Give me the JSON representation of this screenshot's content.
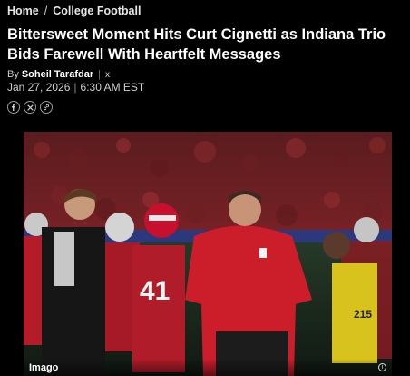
{
  "breadcrumb": {
    "home": "Home",
    "separator": "/",
    "section": "College Football"
  },
  "article": {
    "headline": "Bittersweet Moment Hits Curt Cignetti as Indiana Trio Bids Farewell With Heartfelt Messages",
    "by_prefix": "By",
    "author": "Soheil Tarafdar",
    "author_social": "x",
    "date": "Jan 27, 2026",
    "time": "6:30 AM EST"
  },
  "share": {
    "icons": [
      "facebook-icon",
      "x-icon",
      "link-icon"
    ]
  },
  "image": {
    "credit": "Imago",
    "jersey_numbers": [
      "41",
      "215"
    ]
  },
  "colors": {
    "background": "#000000",
    "text": "#ffffff",
    "indiana_crimson": "#c8102e"
  }
}
